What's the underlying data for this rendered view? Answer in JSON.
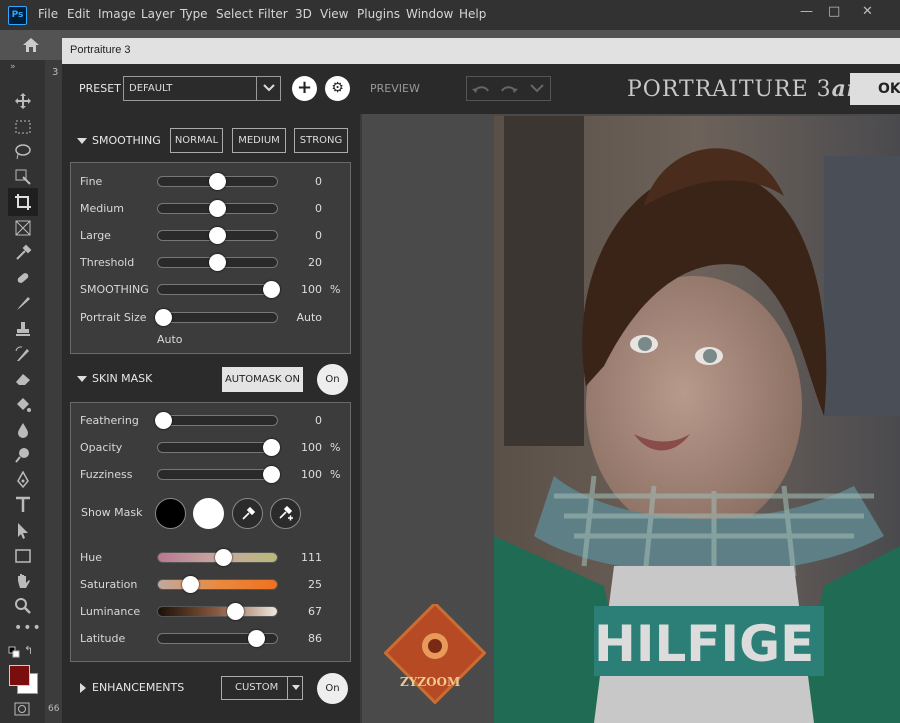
{
  "app": {
    "menu": [
      "File",
      "Edit",
      "Image",
      "Layer",
      "Type",
      "Select",
      "Filter",
      "3D",
      "View",
      "Plugins",
      "Window",
      "Help"
    ],
    "ps_logo": "Ps",
    "window_controls": {
      "minimize": "—",
      "maximize": "□",
      "close": "✕"
    },
    "doc_tab_label": "3",
    "zoom_label": "66"
  },
  "plugin": {
    "window_title": "Portraiture 3",
    "brand": "PORTRAITURE 3",
    "brand_suffix": "ai",
    "preview_label": "PREVIEW",
    "ok_label": "OK",
    "preset": {
      "label": "PRESET",
      "value": "DEFAULT"
    },
    "smoothing": {
      "header": "SMOOTHING",
      "buttons": [
        "NORMAL",
        "MEDIUM",
        "STRONG"
      ],
      "sliders": [
        {
          "label": "Fine",
          "value": "0",
          "pos": 0.5
        },
        {
          "label": "Medium",
          "value": "0",
          "pos": 0.5
        },
        {
          "label": "Large",
          "value": "0",
          "pos": 0.5
        },
        {
          "label": "Threshold",
          "value": "20",
          "pos": 0.5
        },
        {
          "label": "SMOOTHING",
          "value": "100",
          "unit": "%",
          "pos": 0.95
        },
        {
          "label": "Portrait Size",
          "value": "Auto",
          "pos": 0.05
        }
      ],
      "portrait_size_sub": "Auto"
    },
    "skin_mask": {
      "header": "SKIN MASK",
      "automask_label": "AUTOMASK ON",
      "toggle_label": "On",
      "sliders": [
        {
          "label": "Feathering",
          "value": "0",
          "pos": 0.05
        },
        {
          "label": "Opacity",
          "value": "100",
          "unit": "%",
          "pos": 0.95
        },
        {
          "label": "Fuzziness",
          "value": "100",
          "unit": "%",
          "pos": 0.95
        }
      ],
      "show_mask_label": "Show Mask",
      "color_sliders": [
        {
          "label": "Hue",
          "value": "111",
          "pos": 0.55
        },
        {
          "label": "Saturation",
          "value": "25",
          "pos": 0.28
        },
        {
          "label": "Luminance",
          "value": "67",
          "pos": 0.65
        },
        {
          "label": "Latitude",
          "value": "86",
          "pos": 0.82
        }
      ]
    },
    "enhancements": {
      "header": "ENHANCEMENTS",
      "select_label": "CUSTOM",
      "toggle_label": "On"
    },
    "watermark": "ZYZOOM",
    "photo_text": "HILFIGE"
  },
  "colors": {
    "foreground": "#7a0d0d",
    "background": "#ffffff"
  }
}
